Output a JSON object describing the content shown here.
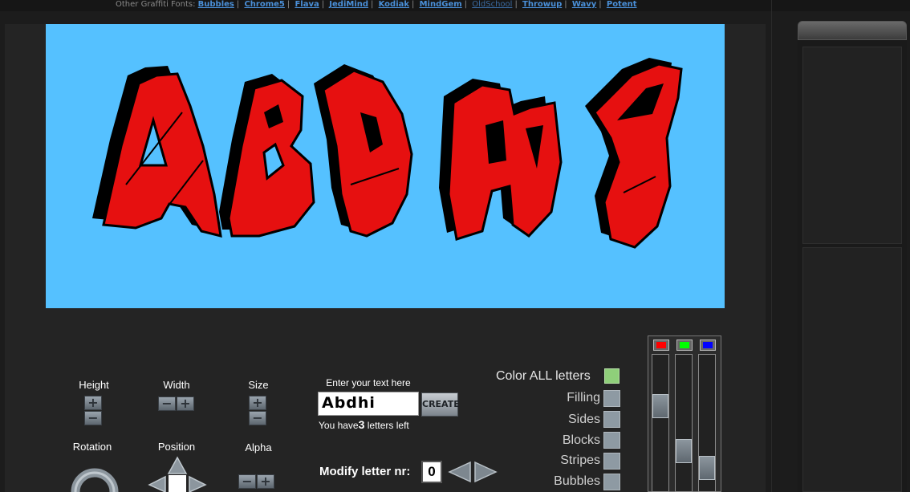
{
  "fonts_bar": {
    "label": "Other Graffiti Fonts:",
    "links": [
      "Bubbles",
      "Chrome5",
      "Flava",
      "JediMind",
      "Kodiak",
      "MindGem",
      "OldSchool",
      "Throwup",
      "Wavy",
      "Potent"
    ]
  },
  "canvas": {
    "background": "#55c1ff",
    "letter_fill": "#e61010",
    "letter_shadow": "#000000"
  },
  "transform": {
    "height_label": "Height",
    "width_label": "Width",
    "size_label": "Size",
    "rotation_label": "Rotation",
    "position_label": "Position",
    "alpha_label": "Alpha",
    "plus": "+",
    "minus": "−"
  },
  "text_entry": {
    "prompt": "Enter your text here",
    "value": "Abdhi",
    "create_label": "CREATE",
    "letters_prefix": "You have",
    "letters_count": "3",
    "letters_suffix": "letters left"
  },
  "modify": {
    "label": "Modify letter nr:",
    "value": "0"
  },
  "colors": {
    "all_label": "Color ALL letters",
    "parts": [
      "Filling",
      "Sides",
      "Blocks",
      "Stripes",
      "Bubbles"
    ]
  },
  "rgb": {
    "channels": [
      "#ff0000",
      "#00ff00",
      "#0000ff"
    ],
    "levels": [
      0.65,
      0.25,
      0.1
    ]
  }
}
